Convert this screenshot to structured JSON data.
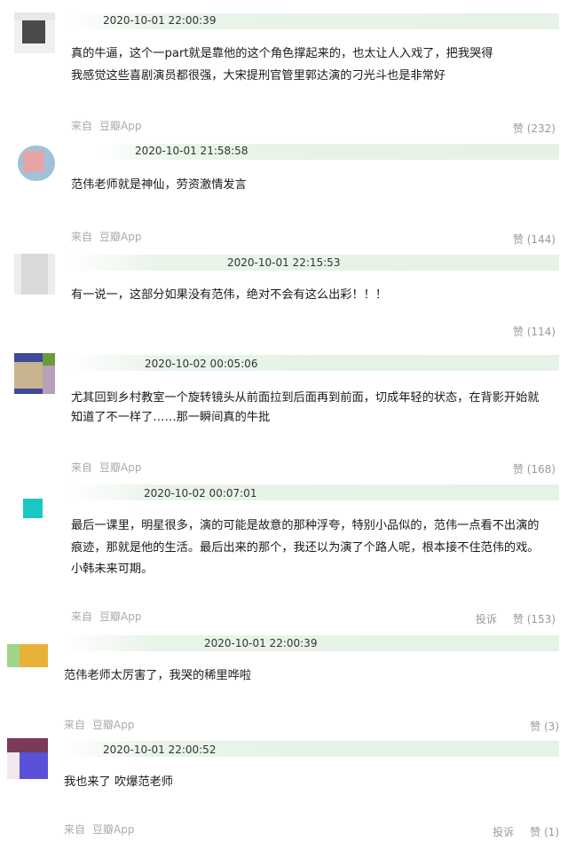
{
  "comments": [
    {
      "time": "2020-10-01 22:00:39",
      "lines": [
        "真的牛逼，这个一part就是靠他的这个角色撑起来的，也太让人入戏了，把我哭得",
        "我感觉这些喜剧演员都很强，大宋提刑官管里郭达演的刁光斗也是非常好"
      ],
      "source_from": "来自",
      "source_app": "豆瓣App",
      "like_label": "赞",
      "like_count": "(232)",
      "avatar_colors": [
        "#3a3a3a",
        "#6b6b6b"
      ]
    },
    {
      "time": "2020-10-01 21:58:58",
      "lines": [
        "范伟老师就是神仙，劳资激情发言"
      ],
      "source_from": "来自",
      "source_app": "豆瓣App",
      "like_label": "赞",
      "like_count": "(144)",
      "avatar_colors": [
        "#e8a3a8",
        "#9ec3d8"
      ]
    },
    {
      "time": "2020-10-01 22:15:53",
      "lines": [
        "有一说一，这部分如果没有范伟，绝对不会有这么出彩！！！"
      ],
      "like_label": "赞",
      "like_count": "(114)",
      "avatar_colors": [
        "#d6d6d6",
        "#c9c9c9"
      ]
    },
    {
      "time": "2020-10-02 00:05:06",
      "lines": [
        "尤其回到乡村教室一个旋转镜头从前面拉到后面再到前面，切成年轻的状态，在背影开始就",
        "知道了不一样了……那一瞬间真的牛批"
      ],
      "source_from": "来自",
      "source_app": "豆瓣App",
      "like_label": "赞",
      "like_count": "(168)",
      "avatar_colors": [
        "#c8b590",
        "#3d4a9a",
        "#6a9a3d"
      ]
    },
    {
      "time": "2020-10-02 00:07:01",
      "lines": [
        "最后一课里，明星很多，演的可能是故意的那种浮夸，特别小品似的，范伟一点看不出演的",
        "痕迹，那就是他的生活。最后出来的那个，我还以为演了个路人呢，根本接不住范伟的戏。",
        "小韩未来可期。"
      ],
      "source_from": "来自",
      "source_app": "豆瓣App",
      "report_label": "投诉",
      "like_label": "赞",
      "like_count": "(153)",
      "avatar_colors": [
        "#1bc8c0"
      ]
    },
    {
      "time": "2020-10-01 22:00:39",
      "lines": [
        "范伟老师太厉害了，我哭的稀里哗啦"
      ],
      "source_from": "来自",
      "source_app": "豆瓣App",
      "like_label": "赞",
      "like_count": "(3)",
      "avatar_colors": [
        "#e8b23a",
        "#9fd68a"
      ]
    },
    {
      "time": "2020-10-01 22:00:52",
      "lines": [
        "我也来了 吹爆范老师"
      ],
      "source_from": "来自",
      "source_app": "豆瓣App",
      "report_label": "投诉",
      "like_label": "赞",
      "like_count": "(1)",
      "avatar_colors": [
        "#5a52d6",
        "#7a3a5a"
      ]
    }
  ]
}
